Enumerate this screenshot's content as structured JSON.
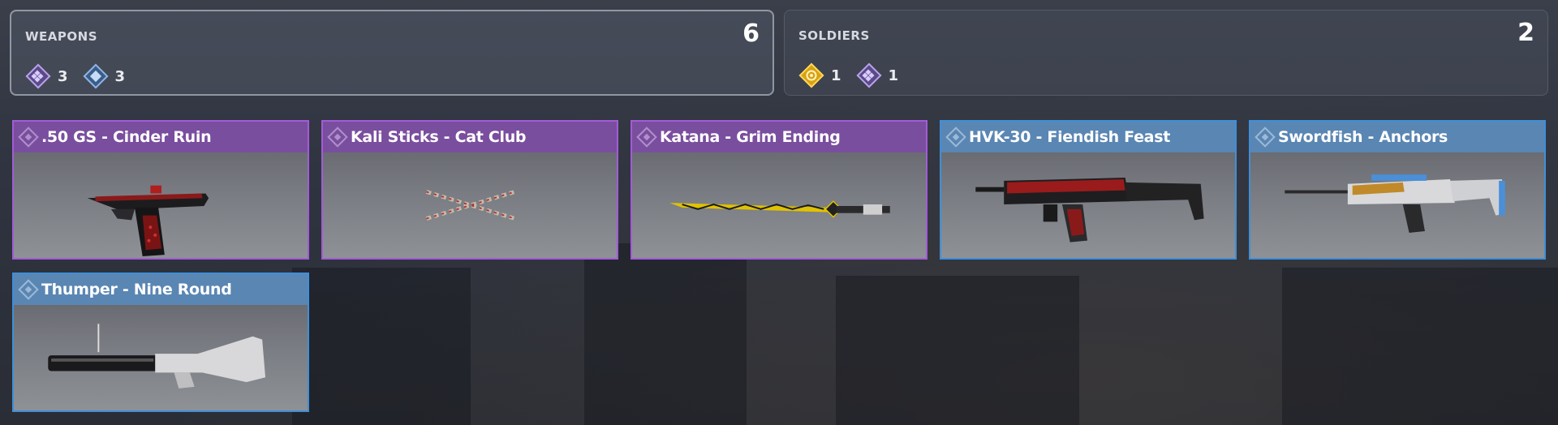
{
  "summary": {
    "weapons": {
      "label": "WEAPONS",
      "count": "6",
      "rarities": [
        {
          "icon": "epic-rarity-icon",
          "color": "#9b7bd6",
          "value": "3"
        },
        {
          "icon": "rare-rarity-icon",
          "color": "#6e9fd9",
          "value": "3"
        }
      ]
    },
    "soldiers": {
      "label": "SOLDIERS",
      "count": "2",
      "rarities": [
        {
          "icon": "legendary-rarity-icon",
          "color": "#e0b11b",
          "value": "1"
        },
        {
          "icon": "epic-rarity-icon",
          "color": "#9b7bd6",
          "value": "1"
        }
      ]
    }
  },
  "items": [
    {
      "title": ".50 GS - Cinder Ruin",
      "rarity": "epic",
      "art": "pistol"
    },
    {
      "title": "Kali Sticks - Cat Club",
      "rarity": "epic",
      "art": "sticks"
    },
    {
      "title": "Katana - Grim Ending",
      "rarity": "epic",
      "art": "katana"
    },
    {
      "title": "HVK-30 - Fiendish Feast",
      "rarity": "rare",
      "art": "rifle-red"
    },
    {
      "title": "Swordfish - Anchors",
      "rarity": "rare",
      "art": "rifle-white"
    },
    {
      "title": "Thumper - Nine Round",
      "rarity": "rare",
      "art": "launcher"
    }
  ],
  "colors": {
    "epic_border": "#a25cd6",
    "epic_header": "#7a4e9e",
    "rare_border": "#3f8fd8",
    "rare_header": "#5a86b3",
    "legendary": "#e0b11b"
  }
}
